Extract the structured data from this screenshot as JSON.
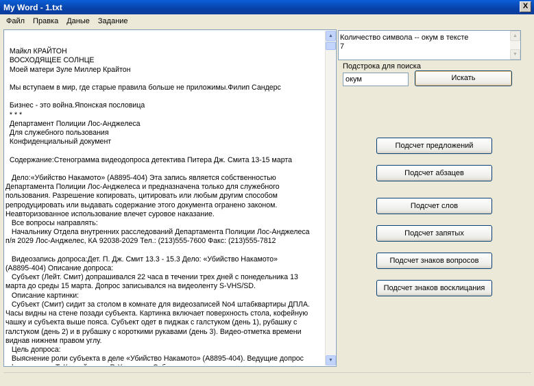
{
  "window": {
    "title": "My Word - 1.txt",
    "close_label": "X"
  },
  "menu": {
    "items": [
      "Файл",
      "Правка",
      "Даные",
      "Задание"
    ]
  },
  "editor": {
    "lines": [
      "",
      "  Майкл КРАЙТОН",
      "  ВОСХОДЯЩЕЕ СОЛНЦЕ",
      "  Моей матери Зуле Миллер Крайтон",
      "",
      "  Мы вступаем в мир, где старые правила больше не приложимы.Филип Сандерс",
      "",
      "  Бизнес - это война.Японская пословица",
      "  * * *",
      "  Департамент Полиции Лос-Анджелеса",
      "  Для служебного пользования",
      "  Конфиденциальный документ",
      "",
      "  Содержание:Стенограмма видеодопроса детектива Питера Дж. Смита 13-15 марта",
      "",
      "   Дело:«Убийство Накамото» (А8895-404) Эта запись является собственностью",
      "Департамента Полиции Лос-Анджелеса и предназначена только для служебного",
      "пользования. Разрешение копировать, цитировать или любым другим способом",
      "репродуцировать или выдавать содержание этого документа огранено законом.",
      "Неавторизованное использование влечет суровое наказание.",
      "   Все вопросы направлять:",
      "   Начальнику Отдела внутренних расследований Департамента Полиции Лос-Анджелеса",
      "п/я 2029 Лос-Анджелес, КА 92038-2029 Тел.: (213)555-7600 Факс: (213)555-7812",
      "",
      "   Видеозапись допроса:Дет. П. Дж. Смит 13.3 - 15.3 Дело: «Убийство Накамото»",
      "(А8895-404) Описание допроса:",
      "   Субъект (Лейт. Смит) допрашивался 22 часа в течении трех дней с понедельника 13",
      "марта до среды 15 марта. Допрос записывался на видеоленту S-VHS/SD.",
      "   Описание картинки:",
      "   Субъект (Смит) сидит за столом в комнате для видеозаписей No4 штабквартиры ДПЛА.",
      "Часы видны на стене позади субъекта. Картинка включает поверхность стола, кофейную",
      "чашку и субъекта выше пояса. Субъект одет в пиджак с галстуком (день 1), рубашку с",
      "галстуком (день 2) и в рубашку с короткими рукавами (день 3). Видео-отметка времени",
      "виднав нижнем правом углу.",
      "   Цель допроса:",
      "   Выяснение роли субъекта в деле «Убийство Накамото» (А8895-404). Ведущие допрос",
      "офицеры: дет. Т. Конвей и дет. Р. Хеммонд. Субъект отказался от права присутствия"
    ]
  },
  "counter": {
    "line1": "Количество символа -- окум в тексте",
    "line2": "7"
  },
  "search": {
    "label": "Подстрока для поиска",
    "value": "окум",
    "button_label": "Искать"
  },
  "buttons": {
    "sentences": "Подсчет предложений",
    "paragraphs": "Подсчет абзацев",
    "words": "Подсчет слов",
    "commas": "Подсчет запятых",
    "question_marks": "Подсчет знаков вопросов",
    "exclamation_marks": "Подсчет знаков восклицания"
  },
  "icons": {
    "scroll_up": "scroll-up-arrow-icon",
    "scroll_down": "scroll-down-arrow-icon"
  }
}
